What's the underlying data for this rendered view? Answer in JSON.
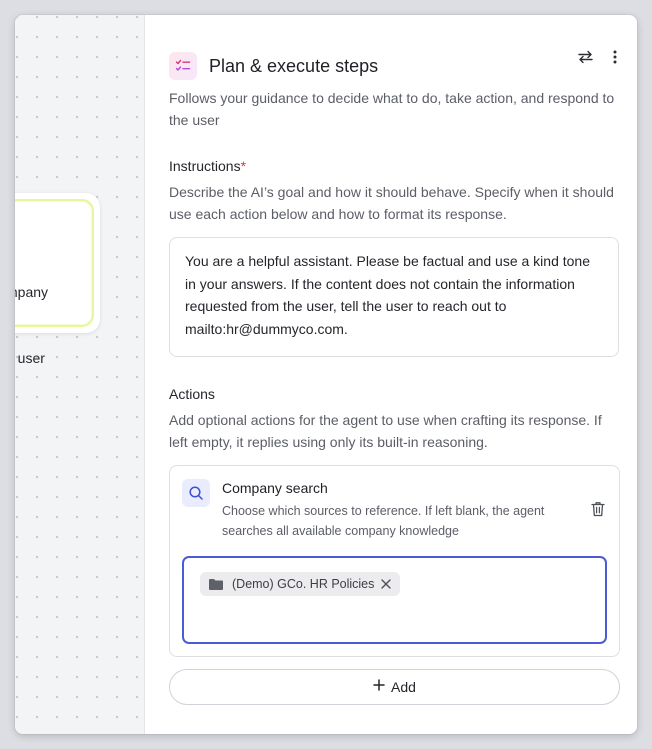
{
  "canvas": {
    "node_text_line1": "mpany",
    "node_text_line2": "e user"
  },
  "panel": {
    "title": "Plan & execute steps",
    "subtitle": "Follows your guidance to decide what to do, take action, and respond to the user",
    "header_icons": [
      "swap-icon",
      "more-vertical-icon"
    ],
    "instructions": {
      "label": "Instructions",
      "required_mark": "*",
      "description": "Describe the AI’s goal and how it should behave. Specify when it should use each action below and how to format its response.",
      "value": "You are a helpful assistant. Please be factual and use a kind tone in your answers.  If the content does not contain the information requested from the user, tell the user to reach out to mailto:hr@dummyco.com."
    },
    "actions": {
      "label": "Actions",
      "description": "Add optional actions for the agent to use when crafting its response. If left empty, it replies using only its built-in reasoning.",
      "items": [
        {
          "title": "Company search",
          "icon": "search-icon",
          "description": "Choose which sources to reference. If left blank, the agent searches all available company knowledge",
          "sources": [
            {
              "label": "(Demo) GCo. HR Policies",
              "icon": "folder-icon"
            }
          ]
        }
      ],
      "add_label": "Add"
    }
  },
  "colors": {
    "accent": "#4a5bd6",
    "required": "#d9363e",
    "node_border": "#e4f79a"
  }
}
